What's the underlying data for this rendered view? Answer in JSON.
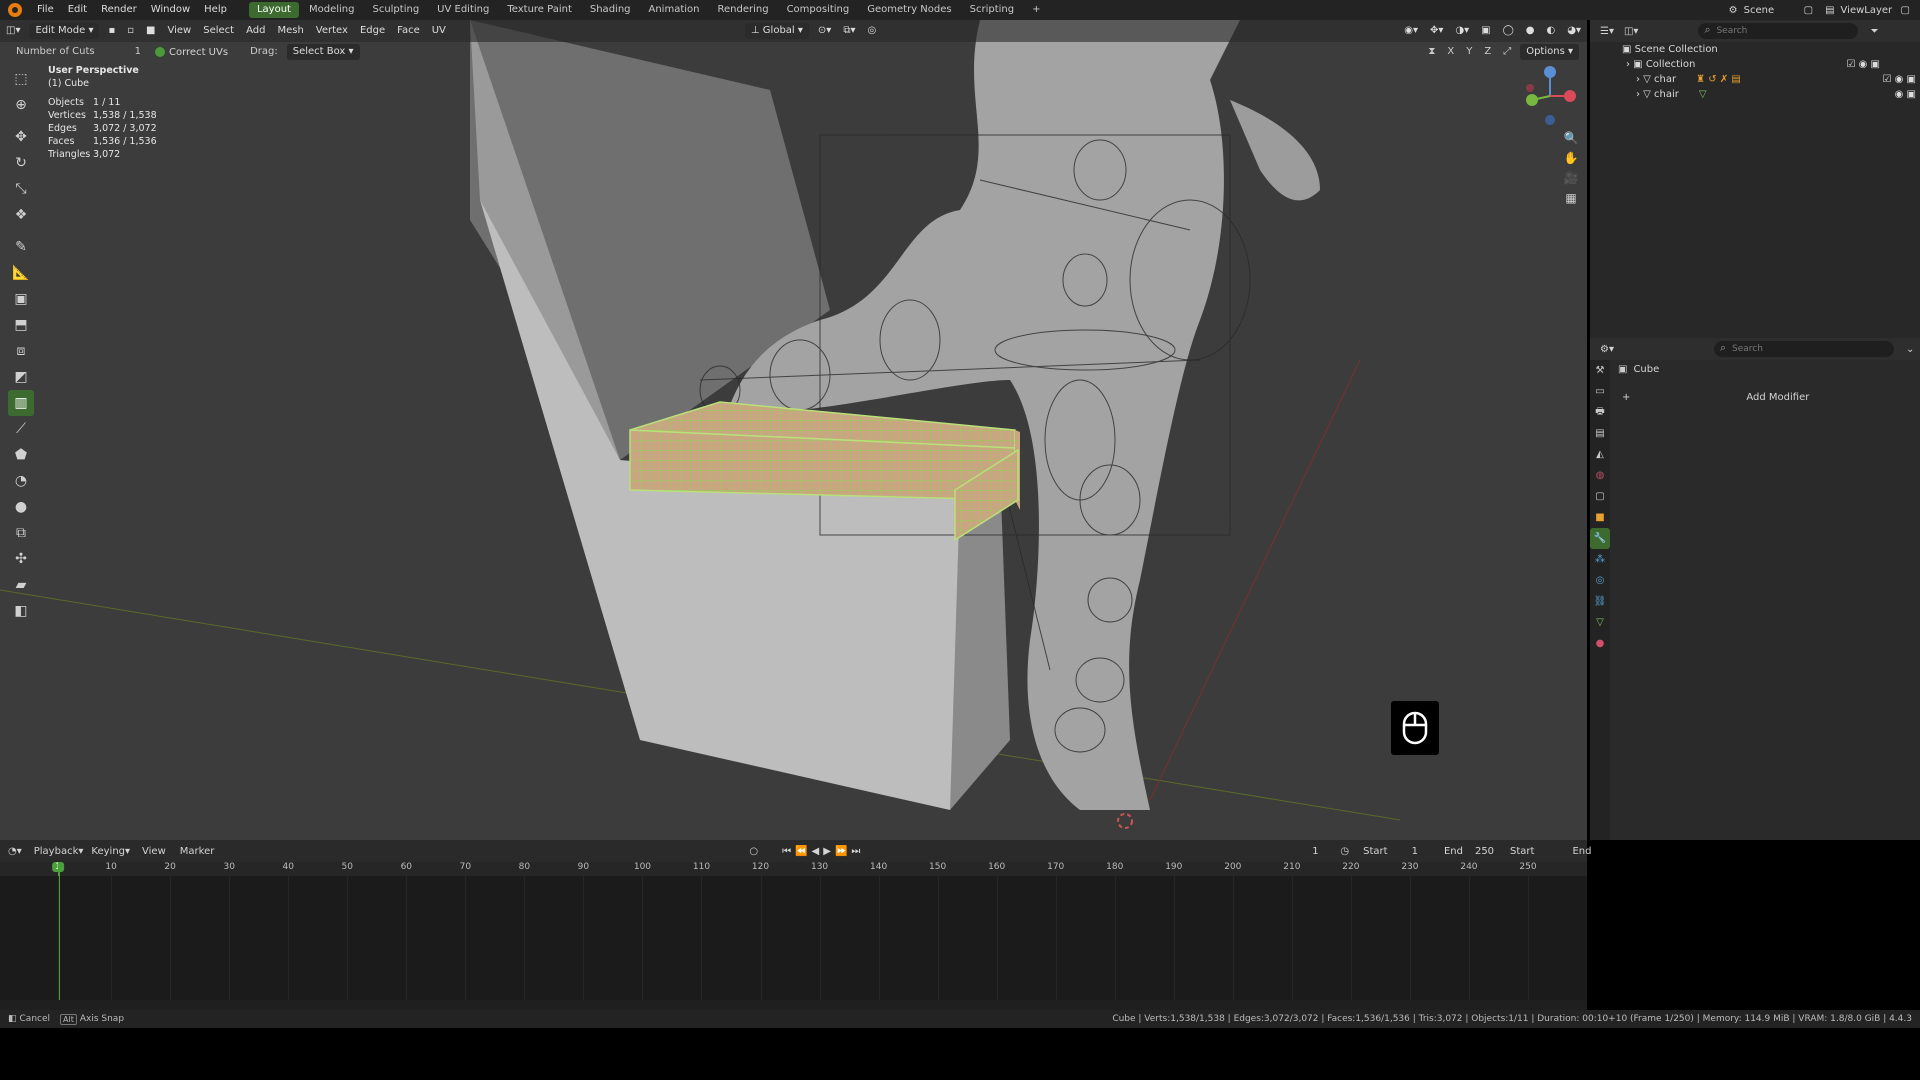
{
  "menu": [
    "File",
    "Edit",
    "Render",
    "Window",
    "Help"
  ],
  "workspaces": [
    "Layout",
    "Modeling",
    "Sculpting",
    "UV Editing",
    "Texture Paint",
    "Shading",
    "Animation",
    "Rendering",
    "Compositing",
    "Geometry Nodes",
    "Scripting"
  ],
  "active_workspace": "Layout",
  "scene": "Scene",
  "view_layer": "ViewLayer",
  "viewport": {
    "mode": "Edit Mode",
    "menus": [
      "View",
      "Select",
      "Add",
      "Mesh",
      "Vertex",
      "Edge",
      "Face",
      "UV"
    ],
    "orientation": "Global",
    "options": "Options",
    "axes": [
      "X",
      "Y",
      "Z"
    ]
  },
  "tool_settings": {
    "cuts_label": "Number of Cuts",
    "cuts_value": "1",
    "correct_uvs": "Correct UVs",
    "drag_label": "Drag:",
    "drag_value": "Select Box"
  },
  "overlay": {
    "perspective": "User Perspective",
    "object": "(1) Cube",
    "stats": [
      {
        "label": "Objects",
        "value": "1 / 11"
      },
      {
        "label": "Vertices",
        "value": "1,538 / 1,538"
      },
      {
        "label": "Edges",
        "value": "3,072 / 3,072"
      },
      {
        "label": "Faces",
        "value": "1,536 / 1,536"
      },
      {
        "label": "Triangles",
        "value": "3,072"
      }
    ]
  },
  "outliner": {
    "search_placeholder": "Search",
    "items": [
      {
        "name": "Scene Collection"
      },
      {
        "name": "Collection"
      },
      {
        "name": "char"
      },
      {
        "name": "chair"
      }
    ]
  },
  "properties": {
    "search_placeholder": "Search",
    "object_name": "Cube",
    "add_modifier": "Add Modifier"
  },
  "timeline": {
    "menus": [
      "Playback",
      "Keying",
      "View",
      "Marker"
    ],
    "current_frame": "1",
    "start_label": "Start",
    "start_value": "1",
    "end_label": "End",
    "end_value": "250",
    "right_start": "Start",
    "right_end": "End",
    "ticks": [
      "1",
      "10",
      "20",
      "30",
      "40",
      "50",
      "60",
      "70",
      "80",
      "90",
      "100",
      "110",
      "120",
      "130",
      "140",
      "150",
      "160",
      "170",
      "180",
      "190",
      "200",
      "210",
      "220",
      "230",
      "240",
      "250"
    ]
  },
  "statusbar": {
    "cancel": "Cancel",
    "alt_key": "Alt",
    "axis_snap": "Axis Snap",
    "info": "Cube | Verts:1,538/1,538 | Edges:3,072/3,072 | Faces:1,536/1,536 | Tris:3,072 | Objects:1/11 | Duration: 00:10+10 (Frame 1/250) | Memory: 114.9 MiB | VRAM: 1.8/8.0 GiB | 4.4.3"
  },
  "colors": {
    "accent_green": "#3d6b2f",
    "selection_mesh": "#b9d98a",
    "blender_orange": "#e87d0d"
  }
}
